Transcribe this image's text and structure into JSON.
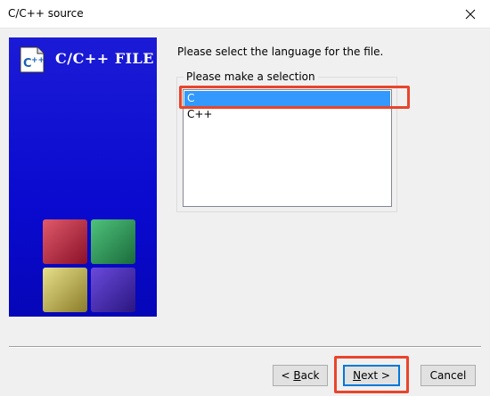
{
  "window": {
    "title": "C/C++ source"
  },
  "banner": {
    "text": "C/C++ FILE",
    "icon": "cpp-file-icon"
  },
  "main": {
    "instruction": "Please select the language for the file.",
    "group_label": "Please make a selection",
    "items": [
      {
        "label": "C",
        "selected": true
      },
      {
        "label": "C++",
        "selected": false
      }
    ]
  },
  "buttons": {
    "back": {
      "mnemonic": "B",
      "rest": "ack",
      "prefix": "< "
    },
    "next": {
      "mnemonic": "N",
      "rest": "ext >"
    },
    "cancel": {
      "label": "Cancel"
    }
  },
  "colors": {
    "banner": "#0a0ad0",
    "selection": "#3399ff",
    "highlight": "#e8452c"
  }
}
